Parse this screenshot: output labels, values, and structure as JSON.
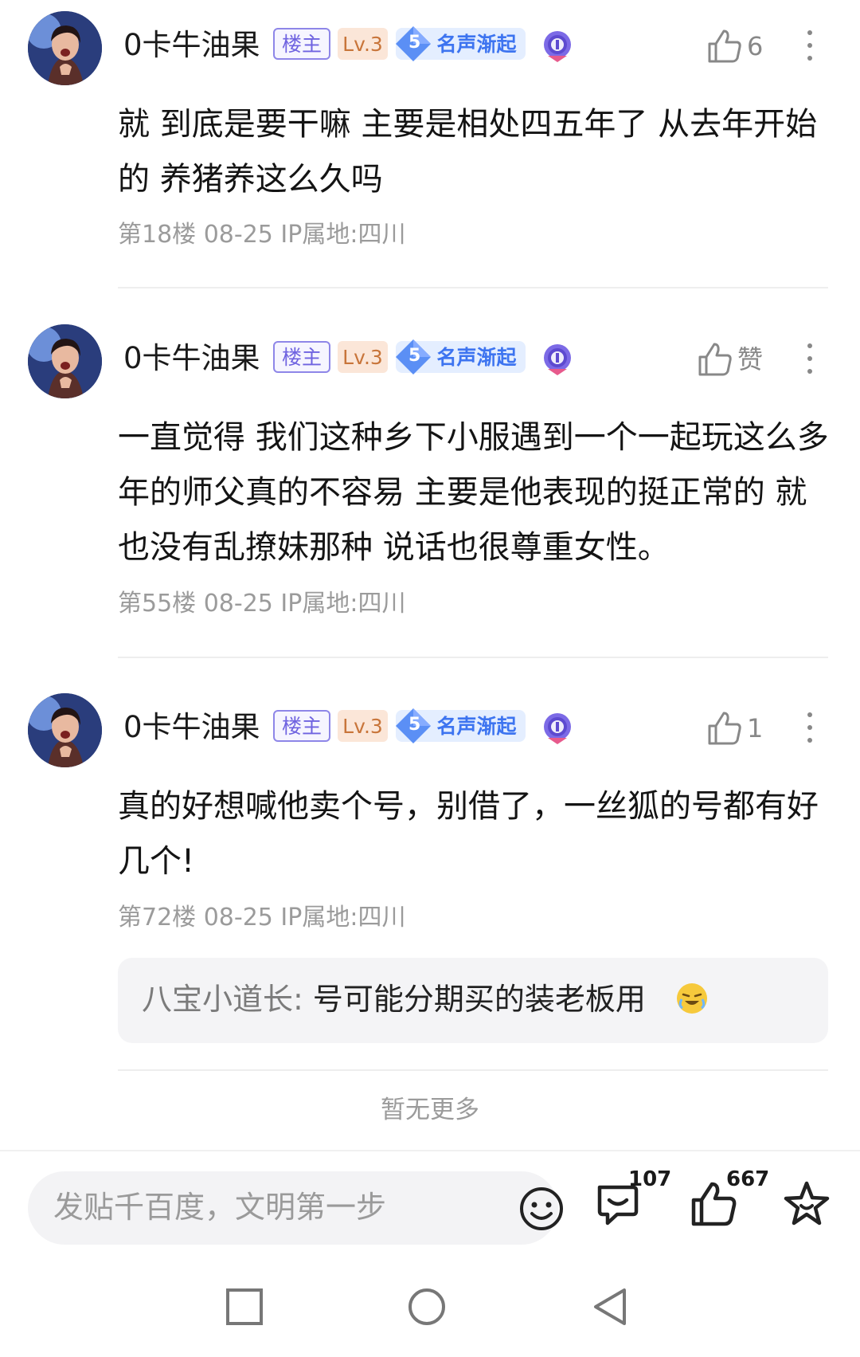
{
  "posts": [
    {
      "username": "0卡牛油果",
      "owner_badge": "楼主",
      "level": "Lv.3",
      "reputation_level": "5",
      "reputation_title": "名声渐起",
      "likes": "6",
      "content": "就 到底是要干嘛 主要是相处四五年了 从去年开始的 养猪养这么久吗",
      "meta": "第18楼  08-25  IP属地:四川"
    },
    {
      "username": "0卡牛油果",
      "owner_badge": "楼主",
      "level": "Lv.3",
      "reputation_level": "5",
      "reputation_title": "名声渐起",
      "likes": "赞",
      "content": "一直觉得 我们这种乡下小服遇到一个一起玩这么多年的师父真的不容易 主要是他表现的挺正常的 就也没有乱撩妹那种 说话也很尊重女性。",
      "meta": "第55楼  08-25  IP属地:四川"
    },
    {
      "username": "0卡牛油果",
      "owner_badge": "楼主",
      "level": "Lv.3",
      "reputation_level": "5",
      "reputation_title": "名声渐起",
      "likes": "1",
      "content": "真的好想喊他卖个号，别借了，一丝狐的号都有好几个!",
      "meta": "第72楼  08-25  IP属地:四川",
      "reply": {
        "author": "八宝小道长:",
        "text": " 号可能分期买的装老板用"
      }
    }
  ],
  "no_more": "暂无更多",
  "bottom_bar": {
    "input_placeholder": "发贴千百度，文明第一步",
    "comment_count": "107",
    "like_count": "667"
  },
  "icons": {
    "like": "thumb-up-icon",
    "more": "more-vertical-icon",
    "emoji": "smiley-icon",
    "comment": "comment-icon",
    "favorite": "star-icon",
    "medal": "medal-icon"
  },
  "colors": {
    "owner_badge": "#6f63e0",
    "level_badge": "#c8753a",
    "reputation_badge": "#3d74f0",
    "meta_text": "#9b9b9b"
  }
}
